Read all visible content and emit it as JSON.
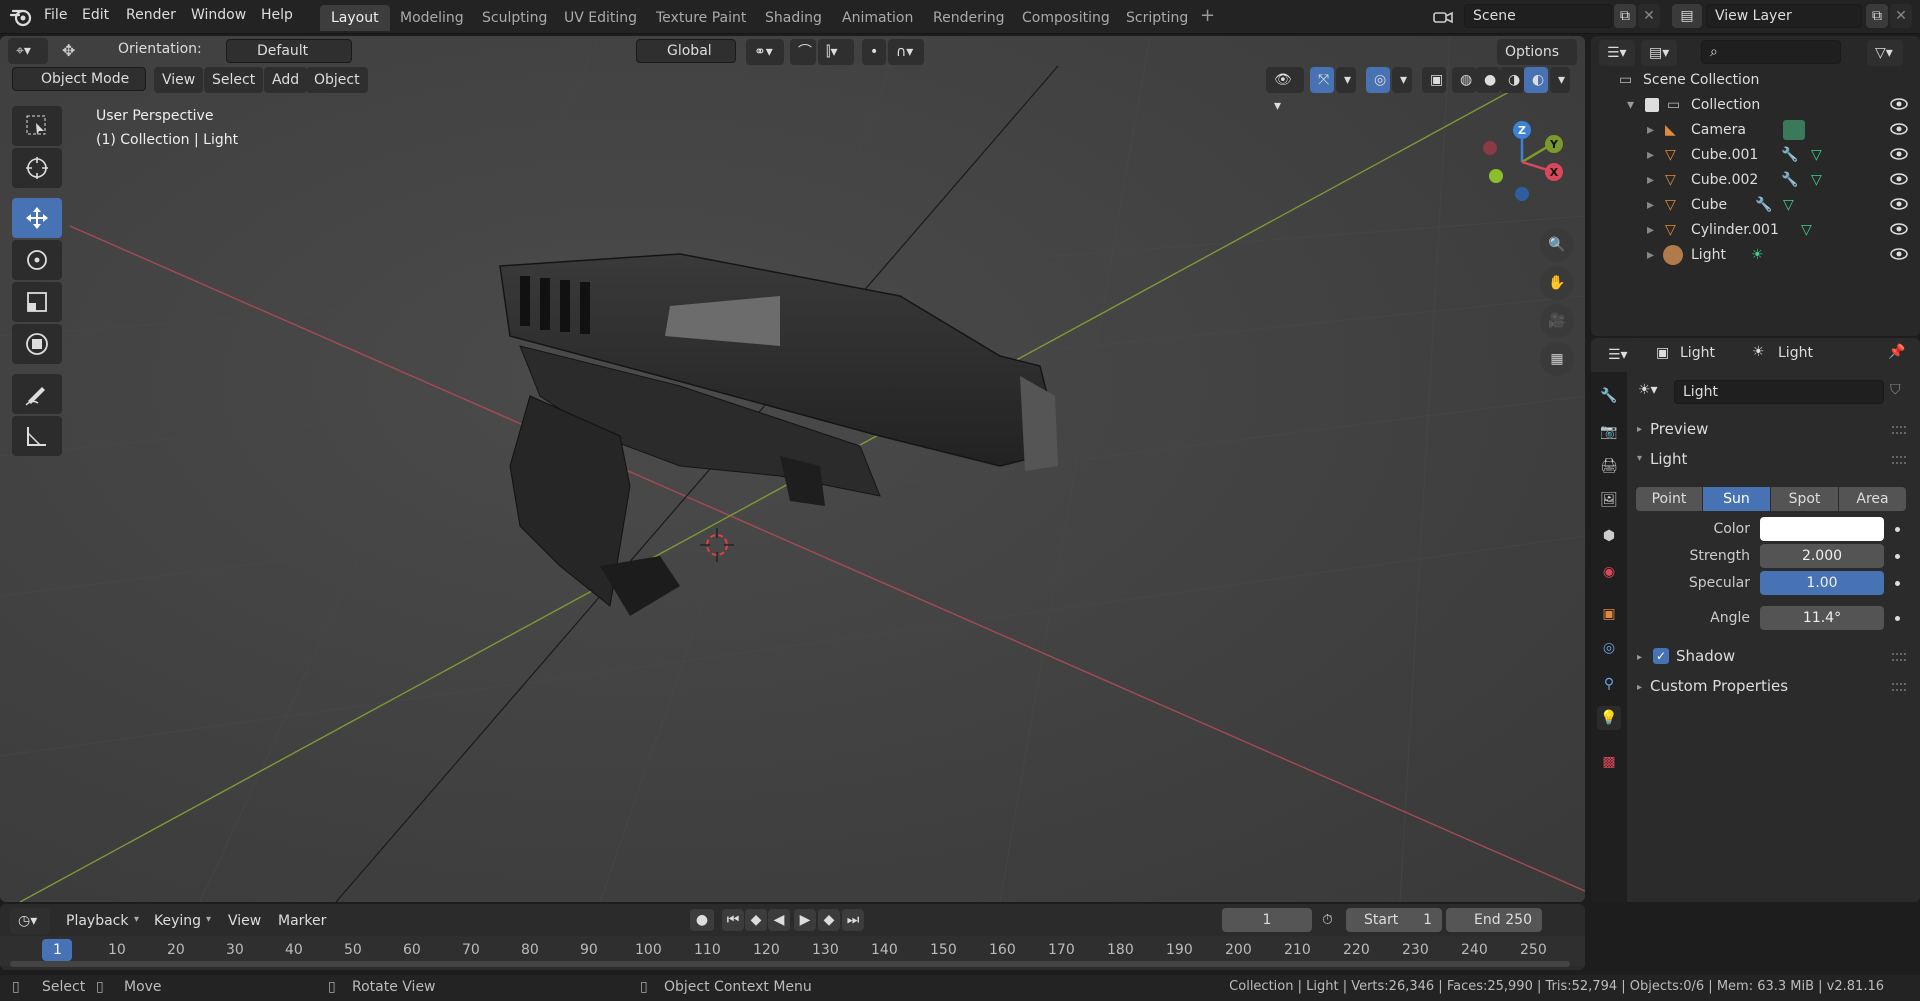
{
  "menu": [
    "File",
    "Edit",
    "Render",
    "Window",
    "Help"
  ],
  "workspaces": [
    "Layout",
    "Modeling",
    "Sculpting",
    "UV Editing",
    "Texture Paint",
    "Shading",
    "Animation",
    "Rendering",
    "Compositing",
    "Scripting"
  ],
  "active_workspace": "Layout",
  "scene": {
    "label": "Scene"
  },
  "view_layer": {
    "label": "View Layer"
  },
  "tool_header": {
    "orientation_label": "Orientation:",
    "orientation_value": "Default",
    "transform": "Global",
    "options": "Options"
  },
  "viewport_header": {
    "mode": "Object Mode",
    "view": "View",
    "select": "Select",
    "add": "Add",
    "object": "Object"
  },
  "viewport_overlay": {
    "line1": "User Perspective",
    "line2": "(1) Collection | Light"
  },
  "gizmo_axes": {
    "x": "X",
    "y": "Y",
    "z": "Z"
  },
  "outliner": {
    "root": "Scene Collection",
    "collection": "Collection",
    "items": [
      {
        "label": "Camera",
        "type": "camera"
      },
      {
        "label": "Cube.001",
        "type": "mesh"
      },
      {
        "label": "Cube.002",
        "type": "mesh"
      },
      {
        "label": "Cube",
        "type": "mesh"
      },
      {
        "label": "Cylinder.001",
        "type": "mesh"
      },
      {
        "label": "Light",
        "type": "light"
      }
    ]
  },
  "properties": {
    "breadcrumb_object": "Light",
    "breadcrumb_data": "Light",
    "datablock_name": "Light",
    "panel_preview": "Preview",
    "panel_light": "Light",
    "light_types": [
      "Point",
      "Sun",
      "Spot",
      "Area"
    ],
    "active_light_type": "Sun",
    "color_label": "Color",
    "color_value": "#ffffff",
    "strength_label": "Strength",
    "strength_value": "2.000",
    "specular_label": "Specular",
    "specular_value": "1.00",
    "angle_label": "Angle",
    "angle_value": "11.4°",
    "shadow_label": "Shadow",
    "shadow_checked": true,
    "custom_props": "Custom Properties"
  },
  "timeline": {
    "playback": "Playback",
    "keying": "Keying",
    "view": "View",
    "marker": "Marker",
    "current_frame": "1",
    "start_label": "Start",
    "start_value": "1",
    "end_label": "End",
    "end_value": "250",
    "ruler": [
      "1",
      "10",
      "20",
      "30",
      "40",
      "50",
      "60",
      "70",
      "80",
      "90",
      "100",
      "110",
      "120",
      "130",
      "140",
      "150",
      "160",
      "170",
      "180",
      "190",
      "200",
      "210",
      "220",
      "230",
      "240",
      "250"
    ]
  },
  "statusbar": {
    "select": "Select",
    "move": "Move",
    "rotate": "Rotate View",
    "context": "Object Context Menu",
    "stats": "Collection | Light | Verts:26,346 | Faces:25,990 | Tris:52,794 | Objects:0/6 | Mem: 63.3 MiB | v2.81.16"
  },
  "colors": {
    "accent": "#4772b3",
    "x_axis": "#d9485a",
    "y_axis": "#7a9a2a",
    "z_axis": "#3b82d8"
  }
}
